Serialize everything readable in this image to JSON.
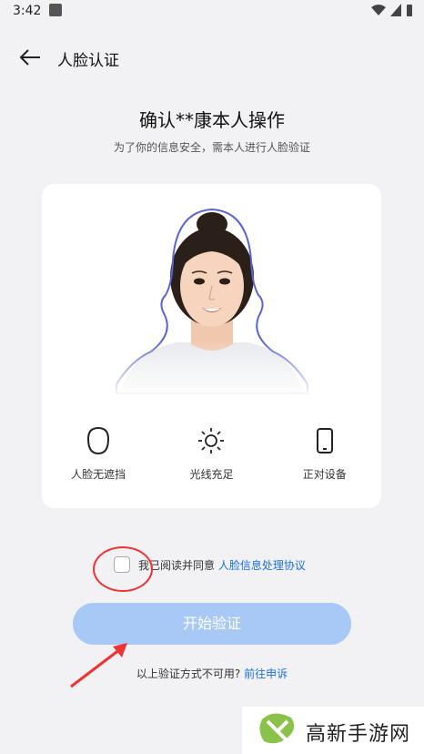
{
  "status": {
    "time": "3:42"
  },
  "header": {
    "title": "人脸认证"
  },
  "main": {
    "heading": "确认**康本人操作",
    "subheading": "为了你的信息安全，需本人进行人脸验证"
  },
  "tips": [
    {
      "label": "人脸无遮挡",
      "icon": "face-outline-icon"
    },
    {
      "label": "光线充足",
      "icon": "sun-icon"
    },
    {
      "label": "正对设备",
      "icon": "phone-icon"
    }
  ],
  "agreement": {
    "text": "我已阅读并同意",
    "link": "人脸信息处理协议",
    "checked": false
  },
  "start_button": {
    "label": "开始验证"
  },
  "alternative": {
    "text": "以上验证方式不可用?",
    "link": "前往申诉"
  },
  "watermark": {
    "text": "高新手游网"
  },
  "colors": {
    "accent": "#1a6fe6",
    "button": "#a8c8f5",
    "annotation": "#e33333"
  }
}
